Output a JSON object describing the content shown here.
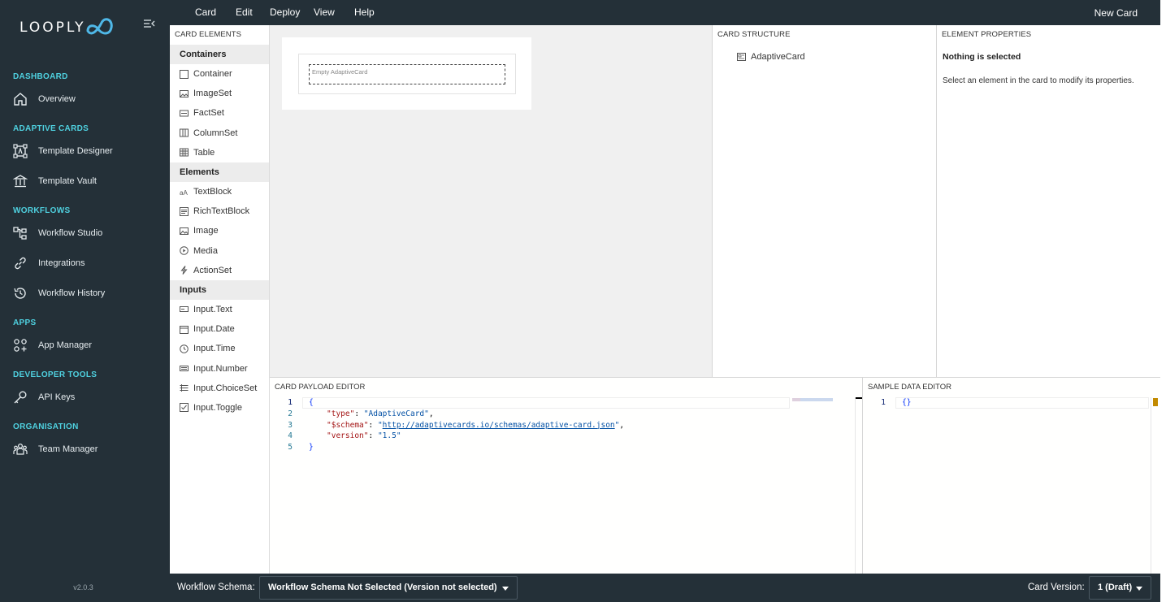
{
  "sidebar": {
    "logo_text": "LOOPLY",
    "version": "v2.0.3",
    "sections": [
      {
        "heading": "DASHBOARD",
        "items": [
          {
            "label": "Overview",
            "icon": "home-icon"
          }
        ]
      },
      {
        "heading": "ADAPTIVE CARDS",
        "items": [
          {
            "label": "Template Designer",
            "icon": "designer-icon"
          },
          {
            "label": "Template Vault",
            "icon": "vault-icon"
          }
        ]
      },
      {
        "heading": "WORKFLOWS",
        "items": [
          {
            "label": "Workflow Studio",
            "icon": "workflow-icon"
          },
          {
            "label": "Integrations",
            "icon": "link-icon"
          },
          {
            "label": "Workflow History",
            "icon": "history-icon"
          }
        ]
      },
      {
        "heading": "APPS",
        "items": [
          {
            "label": "App Manager",
            "icon": "apps-icon"
          }
        ]
      },
      {
        "heading": "DEVELOPER TOOLS",
        "items": [
          {
            "label": "API Keys",
            "icon": "key-icon"
          }
        ]
      },
      {
        "heading": "ORGANISATION",
        "items": [
          {
            "label": "Team Manager",
            "icon": "team-icon"
          }
        ]
      }
    ]
  },
  "menubar": {
    "items": [
      "Card",
      "Edit",
      "Deploy",
      "View",
      "Help"
    ],
    "new_card": "New Card"
  },
  "toolbox": {
    "title": "CARD ELEMENTS",
    "groups": [
      {
        "name": "Containers",
        "items": [
          "Container",
          "ImageSet",
          "FactSet",
          "ColumnSet",
          "Table"
        ]
      },
      {
        "name": "Elements",
        "items": [
          "TextBlock",
          "RichTextBlock",
          "Image",
          "Media",
          "ActionSet"
        ]
      },
      {
        "name": "Inputs",
        "items": [
          "Input.Text",
          "Input.Date",
          "Input.Time",
          "Input.Number",
          "Input.ChoiceSet",
          "Input.Toggle"
        ]
      }
    ]
  },
  "canvas": {
    "empty_label": "Empty AdaptiveCard"
  },
  "structure": {
    "title": "CARD STRUCTURE",
    "root": "AdaptiveCard"
  },
  "properties": {
    "title": "ELEMENT PROPERTIES",
    "nothing": "Nothing is selected",
    "hint": "Select an element in the card to modify its properties."
  },
  "payload_editor": {
    "title": "CARD PAYLOAD EDITOR",
    "lines": [
      {
        "n": "1",
        "open": "{"
      },
      {
        "n": "2",
        "key": "\"type\"",
        "value": "\"AdaptiveCard\"",
        "trail": ","
      },
      {
        "n": "3",
        "key": "\"$schema\"",
        "q1": "\"",
        "link": "http://adaptivecards.io/schemas/adaptive-card.json",
        "q2": "\"",
        "trail": ","
      },
      {
        "n": "4",
        "key": "\"version\"",
        "value": "\"1.5\"",
        "trail": ""
      },
      {
        "n": "5",
        "open": "}"
      }
    ]
  },
  "sample_editor": {
    "title": "SAMPLE DATA EDITOR",
    "line_no": "1",
    "content": "{}"
  },
  "footer": {
    "schema_label": "Workflow Schema:",
    "schema_value": "Workflow Schema Not Selected (Version not selected)",
    "version_label": "Card Version:",
    "version_value": "1 (Draft)"
  },
  "colors": {
    "sidebar_bg": "#243038",
    "section_heading": "#4fd1e0",
    "canvas_bg": "#f0f0f0"
  }
}
